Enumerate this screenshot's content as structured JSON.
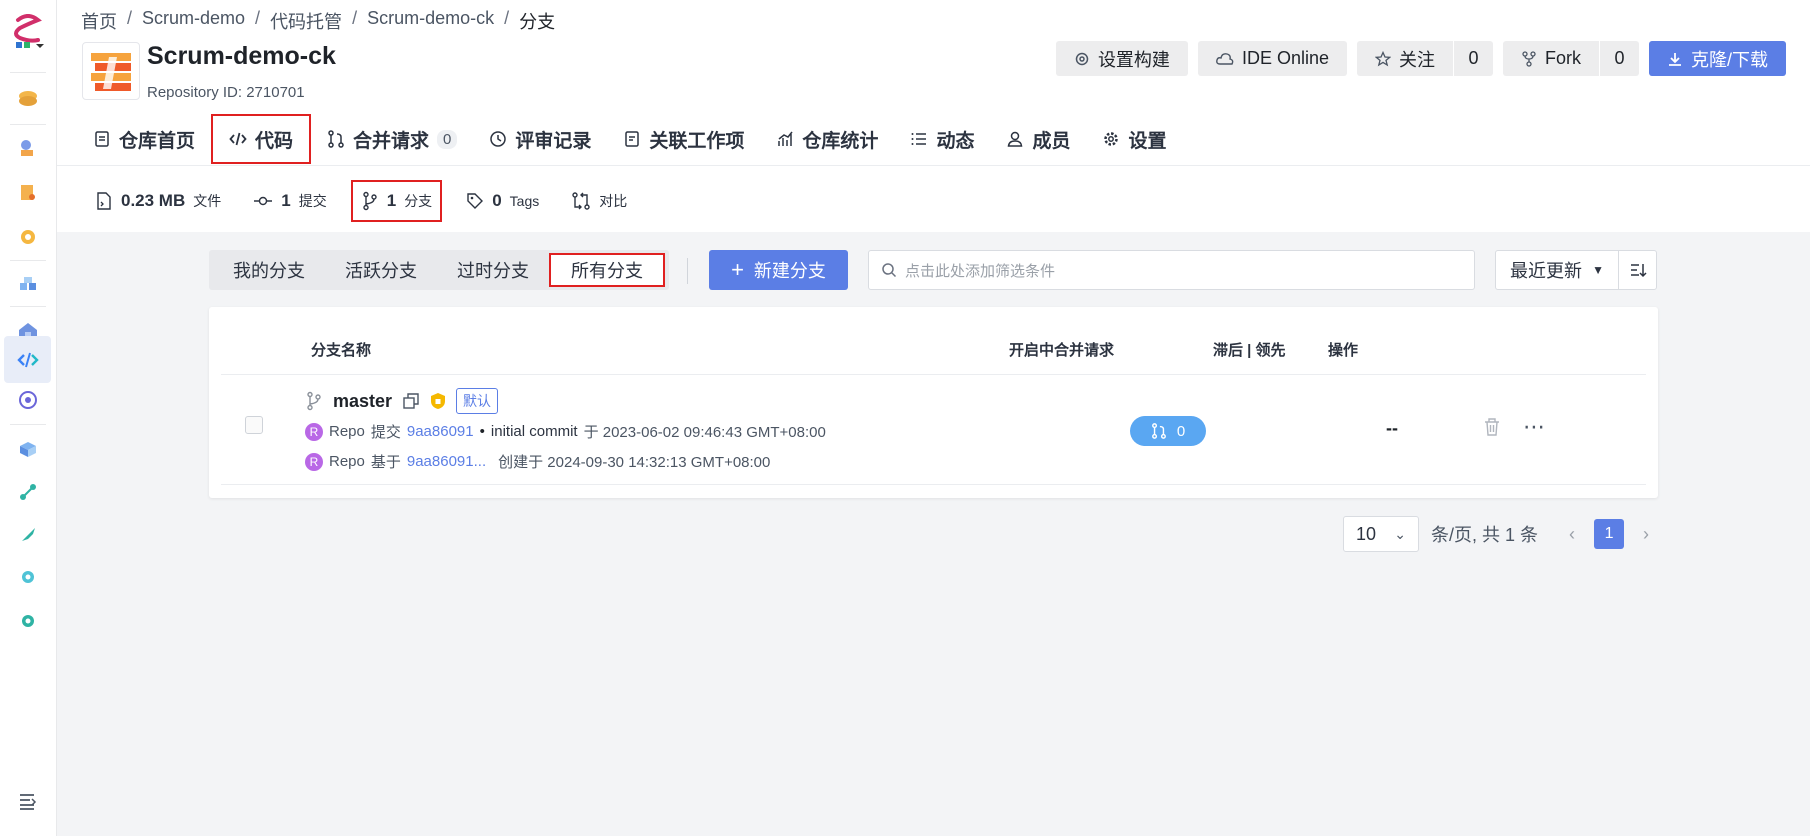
{
  "breadcrumb": [
    "首页",
    "Scrum-demo",
    "代码托管",
    "Scrum-demo-ck",
    "分支"
  ],
  "repo": {
    "name": "Scrum-demo-ck",
    "id_text": "Repository ID: 2710701"
  },
  "actions": {
    "settings_build": "设置构建",
    "ide_online": "IDE Online",
    "watch": "关注",
    "watch_count": "0",
    "fork": "Fork",
    "fork_count": "0",
    "clone": "克隆/下载"
  },
  "tabs": [
    {
      "label": "仓库首页"
    },
    {
      "label": "代码"
    },
    {
      "label": "合并请求",
      "badge": "0"
    },
    {
      "label": "评审记录"
    },
    {
      "label": "关联工作项"
    },
    {
      "label": "仓库统计"
    },
    {
      "label": "动态"
    },
    {
      "label": "成员"
    },
    {
      "label": "设置"
    }
  ],
  "stats": {
    "size": "0.23 MB",
    "size_label": "文件",
    "commits": "1",
    "commits_label": "提交",
    "branches": "1",
    "branches_label": "分支",
    "tags": "0",
    "tags_label": "Tags",
    "compare_label": "对比"
  },
  "filters": {
    "mine": "我的分支",
    "active": "活跃分支",
    "stale": "过时分支",
    "all": "所有分支"
  },
  "new_branch": "新建分支",
  "search_placeholder": "点击此处添加筛选条件",
  "sort": {
    "selected": "最近更新"
  },
  "table": {
    "headers": {
      "name": "分支名称",
      "mr": "开启中合并请求",
      "behind_ahead": "滞后 | 领先",
      "ops": "操作"
    },
    "rows": [
      {
        "name": "master",
        "default_tag": "默认",
        "commit_author": "Repo",
        "commit_verb": "提交",
        "commit_hash": "9aa86091",
        "commit_msg": "initial commit",
        "commit_time": "于 2023-06-02 09:46:43 GMT+08:00",
        "base_author": "Repo",
        "base_verb": "基于",
        "base_hash": "9aa86091...",
        "created": "创建于 2024-09-30 14:32:13 GMT+08:00",
        "avatar_letter": "R",
        "mr_count": "0",
        "behind_ahead": "--"
      }
    ]
  },
  "pagination": {
    "page_size": "10",
    "summary": "条/页, 共 1 条",
    "current": "1"
  },
  "colors": {
    "primary": "#5b7ee5",
    "highlight": "#e02020",
    "mr_pill": "#5aa7f2",
    "avatar": "#b968e6"
  }
}
